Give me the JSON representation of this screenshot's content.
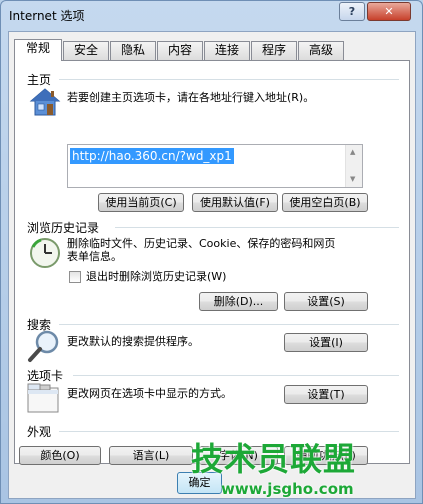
{
  "window": {
    "title": "Internet 选项",
    "help_label": "?",
    "close_label": "✕"
  },
  "tabs": [
    {
      "label": "常规",
      "active": true
    },
    {
      "label": "安全"
    },
    {
      "label": "隐私"
    },
    {
      "label": "内容"
    },
    {
      "label": "连接"
    },
    {
      "label": "程序"
    },
    {
      "label": "高级"
    }
  ],
  "home": {
    "title": "主页",
    "description": "若要创建主页选项卡，请在各地址行键入地址(R)。",
    "url": "http://hao.360.cn/?wd_xp1",
    "icon": "house-icon",
    "buttons": {
      "use_current": "使用当前页(C)",
      "use_default": "使用默认值(F)",
      "use_blank": "使用空白页(B)"
    }
  },
  "history": {
    "title": "浏览历史记录",
    "description_line1": "删除临时文件、历史记录、Cookie、保存的密码和网页",
    "description_line2": "表单信息。",
    "checkbox_label": "退出时删除浏览历史记录(W)",
    "checkbox_checked": false,
    "icon": "history-clock-icon",
    "buttons": {
      "delete": "删除(D)...",
      "settings": "设置(S)"
    }
  },
  "search": {
    "title": "搜索",
    "description": "更改默认的搜索提供程序。",
    "icon": "magnifier-icon",
    "buttons": {
      "settings": "设置(I)"
    }
  },
  "tabs_section": {
    "title": "选项卡",
    "description": "更改网页在选项卡中显示的方式。",
    "icon": "tabs-window-icon",
    "buttons": {
      "settings": "设置(T)"
    }
  },
  "appearance": {
    "title": "外观",
    "buttons": {
      "colors": "颜色(O)",
      "languages": "语言(L)",
      "fonts": "字体(N)",
      "accessibility": "辅助功能(E)"
    }
  },
  "footer": {
    "ok_label": "确定"
  },
  "watermark": {
    "brand": "技术员联盟",
    "url": "www.jsgho.com"
  },
  "colors": {
    "accent_green": "#1da837",
    "selection": "#3399ff",
    "close_red": "#c7402b"
  }
}
